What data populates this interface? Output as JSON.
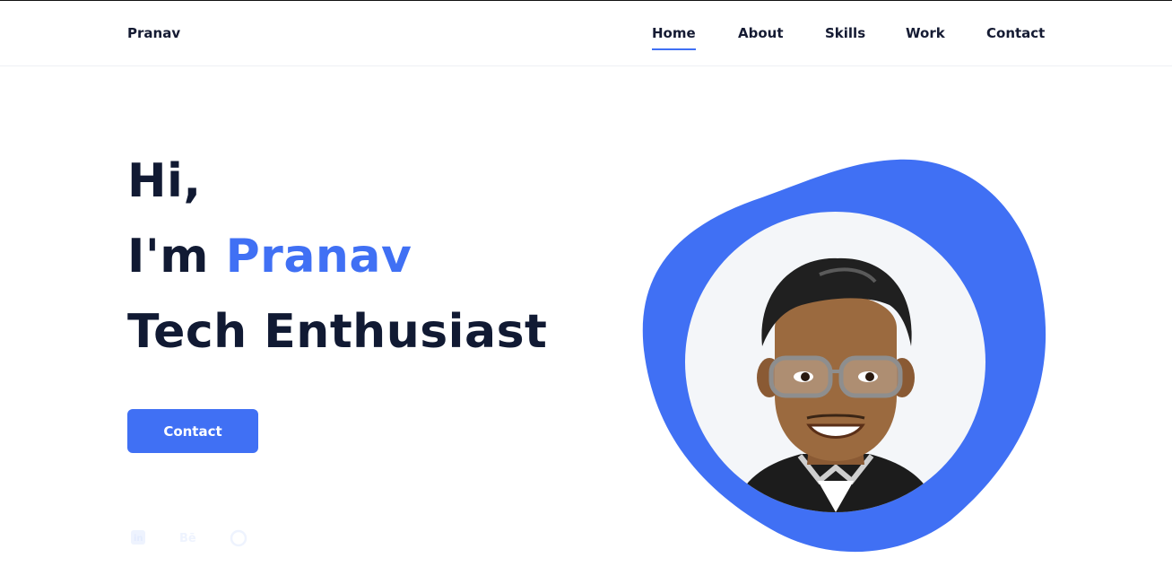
{
  "header": {
    "logo": "Pranav",
    "nav": {
      "home": "Home",
      "about": "About",
      "skills": "Skills",
      "work": "Work",
      "contact": "Contact"
    },
    "active_item": "Home"
  },
  "hero": {
    "greeting": "Hi,",
    "intro_prefix": "I'm ",
    "name": "Pranav",
    "role": "Tech Enthusiast",
    "contact_button": "Contact"
  },
  "social": {
    "linkedin_icon": "linkedin-icon",
    "behance_icon": "behance-icon",
    "github_icon": "github-icon"
  },
  "colors": {
    "accent": "#4070f4",
    "heading": "#111a33",
    "avatar_bg": "#f4f6f9"
  }
}
